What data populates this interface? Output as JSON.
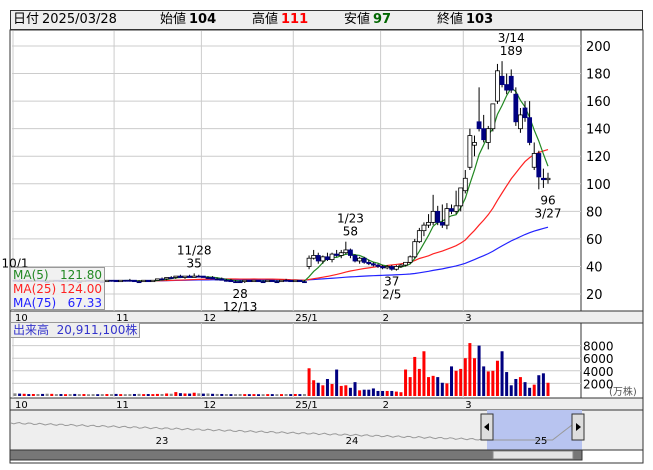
{
  "header": {
    "date_label": "日付",
    "date": "2025/03/28",
    "open_label": "始値",
    "open": "104",
    "high_label": "高値",
    "high": "111",
    "low_label": "安値",
    "low": "97",
    "close_label": "終値",
    "close": "103"
  },
  "legend": {
    "ma5_label": "MA(5)",
    "ma5": "121.80",
    "ma25_label": "MA(25)",
    "ma25": "124.00",
    "ma75_label": "MA(75)",
    "ma75": "67.33"
  },
  "volume_label": "出来高",
  "volume_total": "20,911,100株",
  "volume_unit": "(万株)",
  "colors": {
    "up": "#ff0000",
    "down": "#000080",
    "ma5": "#228822",
    "ma25": "#ff2222",
    "ma75": "#2222ff"
  },
  "navigator": {
    "labels": [
      "23",
      "24",
      "25"
    ]
  },
  "chart_data": {
    "type": "candlestick",
    "price_ticks": [
      20,
      40,
      60,
      80,
      100,
      120,
      140,
      160,
      180,
      200
    ],
    "volume_ticks": [
      2000,
      4000,
      6000,
      8000
    ],
    "ylim": [
      0,
      220
    ],
    "month_labels": [
      {
        "label": "10",
        "index": 0
      },
      {
        "label": "11",
        "index": 22
      },
      {
        "label": "12",
        "index": 41
      },
      {
        "label": "25/1",
        "index": 61
      },
      {
        "label": "2",
        "index": 80
      },
      {
        "label": "3",
        "index": 98
      }
    ],
    "annotations": [
      {
        "index": 0,
        "lines": [
          "10/1"
        ],
        "price": 35,
        "pos": "above"
      },
      {
        "index": 39,
        "lines": [
          "11/28",
          "35"
        ],
        "price": 35,
        "pos": "above"
      },
      {
        "index": 49,
        "lines": [
          "28",
          "12/13"
        ],
        "price": 28,
        "pos": "below"
      },
      {
        "index": 73,
        "lines": [
          "1/23",
          "58"
        ],
        "price": 58,
        "pos": "above"
      },
      {
        "index": 82,
        "lines": [
          "37",
          "2/5"
        ],
        "price": 37,
        "pos": "below"
      },
      {
        "index": 108,
        "lines": [
          "3/14",
          "189"
        ],
        "price": 189,
        "pos": "above"
      },
      {
        "index": 116,
        "lines": [
          "96",
          "3/27"
        ],
        "price": 96,
        "pos": "below"
      }
    ],
    "ohlcv": [
      [
        30,
        31,
        29,
        30,
        420
      ],
      [
        30,
        31,
        29,
        29,
        380
      ],
      [
        29,
        30,
        29,
        30,
        350
      ],
      [
        30,
        30,
        29,
        29,
        300
      ],
      [
        29,
        30,
        29,
        30,
        320
      ],
      [
        30,
        31,
        29,
        30,
        310
      ],
      [
        30,
        30,
        29,
        29,
        330
      ],
      [
        29,
        30,
        28,
        29,
        360
      ],
      [
        29,
        30,
        29,
        30,
        340
      ],
      [
        30,
        30,
        29,
        30,
        300
      ],
      [
        30,
        30,
        29,
        29,
        310
      ],
      [
        29,
        30,
        29,
        30,
        290
      ],
      [
        30,
        31,
        29,
        30,
        300
      ],
      [
        30,
        30,
        29,
        29,
        330
      ],
      [
        29,
        30,
        29,
        29,
        300
      ],
      [
        29,
        30,
        29,
        30,
        310
      ],
      [
        30,
        30,
        29,
        30,
        280
      ],
      [
        30,
        31,
        29,
        30,
        300
      ],
      [
        30,
        30,
        29,
        29,
        290
      ],
      [
        29,
        30,
        29,
        29,
        300
      ],
      [
        29,
        30,
        29,
        30,
        310
      ],
      [
        30,
        30,
        29,
        30,
        300
      ],
      [
        30,
        30,
        29,
        29,
        330
      ],
      [
        29,
        30,
        29,
        30,
        300
      ],
      [
        30,
        30,
        29,
        30,
        290
      ],
      [
        30,
        31,
        29,
        30,
        300
      ],
      [
        30,
        30,
        29,
        29,
        320
      ],
      [
        29,
        30,
        28,
        29,
        340
      ],
      [
        29,
        30,
        29,
        30,
        300
      ],
      [
        30,
        30,
        29,
        29,
        310
      ],
      [
        29,
        30,
        29,
        30,
        300
      ],
      [
        30,
        31,
        30,
        31,
        330
      ],
      [
        31,
        32,
        30,
        31,
        320
      ],
      [
        31,
        32,
        30,
        32,
        400
      ],
      [
        32,
        33,
        31,
        32,
        360
      ],
      [
        32,
        33,
        31,
        33,
        620
      ],
      [
        33,
        34,
        32,
        32,
        450
      ],
      [
        32,
        33,
        31,
        33,
        400
      ],
      [
        33,
        34,
        32,
        32,
        380
      ],
      [
        32,
        35,
        32,
        33,
        520
      ],
      [
        33,
        34,
        32,
        33,
        420
      ],
      [
        33,
        33,
        32,
        32,
        380
      ],
      [
        32,
        33,
        31,
        32,
        400
      ],
      [
        32,
        33,
        31,
        31,
        350
      ],
      [
        31,
        32,
        30,
        31,
        330
      ],
      [
        31,
        32,
        30,
        30,
        320
      ],
      [
        30,
        31,
        29,
        30,
        310
      ],
      [
        30,
        31,
        29,
        29,
        300
      ],
      [
        29,
        30,
        29,
        29,
        300
      ],
      [
        29,
        30,
        28,
        29,
        320
      ],
      [
        29,
        30,
        28,
        30,
        300
      ],
      [
        30,
        30,
        29,
        29,
        290
      ],
      [
        29,
        30,
        29,
        30,
        300
      ],
      [
        30,
        30,
        29,
        29,
        280
      ],
      [
        29,
        30,
        29,
        29,
        290
      ],
      [
        29,
        30,
        29,
        30,
        300
      ],
      [
        30,
        30,
        29,
        29,
        300
      ],
      [
        29,
        30,
        29,
        29,
        290
      ],
      [
        29,
        30,
        29,
        30,
        300
      ],
      [
        30,
        31,
        29,
        30,
        310
      ],
      [
        30,
        30,
        29,
        29,
        300
      ],
      [
        29,
        30,
        29,
        30,
        320
      ],
      [
        30,
        30,
        29,
        29,
        300
      ],
      [
        29,
        30,
        28,
        29,
        310
      ],
      [
        40,
        48,
        38,
        46,
        4400
      ],
      [
        46,
        52,
        45,
        48,
        2500
      ],
      [
        48,
        50,
        42,
        44,
        2100
      ],
      [
        44,
        48,
        42,
        47,
        1700
      ],
      [
        47,
        50,
        44,
        45,
        2700
      ],
      [
        45,
        50,
        43,
        49,
        1900
      ],
      [
        49,
        52,
        47,
        48,
        4200
      ],
      [
        48,
        52,
        46,
        50,
        1600
      ],
      [
        50,
        58,
        49,
        52,
        1700
      ],
      [
        52,
        53,
        46,
        48,
        1300
      ],
      [
        48,
        49,
        43,
        44,
        2200
      ],
      [
        44,
        47,
        42,
        46,
        900
      ],
      [
        46,
        47,
        42,
        43,
        1000
      ],
      [
        43,
        45,
        41,
        42,
        1000
      ],
      [
        42,
        43,
        40,
        41,
        1200
      ],
      [
        41,
        42,
        39,
        40,
        800
      ],
      [
        40,
        41,
        38,
        39,
        800
      ],
      [
        39,
        41,
        38,
        40,
        800
      ],
      [
        40,
        41,
        37,
        38,
        800
      ],
      [
        38,
        41,
        37,
        40,
        700
      ],
      [
        40,
        42,
        39,
        41,
        600
      ],
      [
        41,
        43,
        40,
        43,
        4200
      ],
      [
        43,
        48,
        42,
        47,
        3000
      ],
      [
        47,
        60,
        46,
        58,
        6200
      ],
      [
        58,
        68,
        57,
        66,
        4300
      ],
      [
        66,
        72,
        62,
        70,
        7100
      ],
      [
        70,
        78,
        68,
        72,
        3000
      ],
      [
        72,
        92,
        70,
        80,
        3200
      ],
      [
        80,
        84,
        70,
        72,
        3000
      ],
      [
        72,
        85,
        68,
        70,
        2100
      ],
      [
        70,
        86,
        67,
        82,
        2000
      ],
      [
        82,
        85,
        78,
        80,
        4700
      ],
      [
        80,
        95,
        78,
        84,
        4000
      ],
      [
        84,
        88,
        80,
        97,
        4300
      ],
      [
        95,
        110,
        93,
        104,
        6000
      ],
      [
        112,
        140,
        110,
        135,
        8400
      ],
      [
        128,
        135,
        120,
        130,
        6000
      ],
      [
        145,
        170,
        138,
        140,
        8000
      ],
      [
        140,
        150,
        130,
        132,
        4700
      ],
      [
        130,
        142,
        125,
        140,
        3900
      ],
      [
        140,
        158,
        138,
        158,
        4000
      ],
      [
        160,
        187,
        158,
        182,
        5600
      ],
      [
        178,
        189,
        170,
        172,
        7100
      ],
      [
        172,
        180,
        165,
        168,
        3800
      ],
      [
        178,
        183,
        166,
        168,
        1700
      ],
      [
        165,
        170,
        142,
        145,
        2700
      ],
      [
        140,
        155,
        137,
        150,
        3000
      ],
      [
        155,
        160,
        145,
        148,
        2200
      ],
      [
        148,
        160,
        128,
        130,
        1300
      ],
      [
        112,
        130,
        110,
        122,
        1800
      ],
      [
        122,
        124,
        96,
        105,
        3300
      ],
      [
        104,
        111,
        97,
        103,
        3600
      ],
      [
        103,
        108,
        100,
        104,
        2100
      ]
    ]
  }
}
